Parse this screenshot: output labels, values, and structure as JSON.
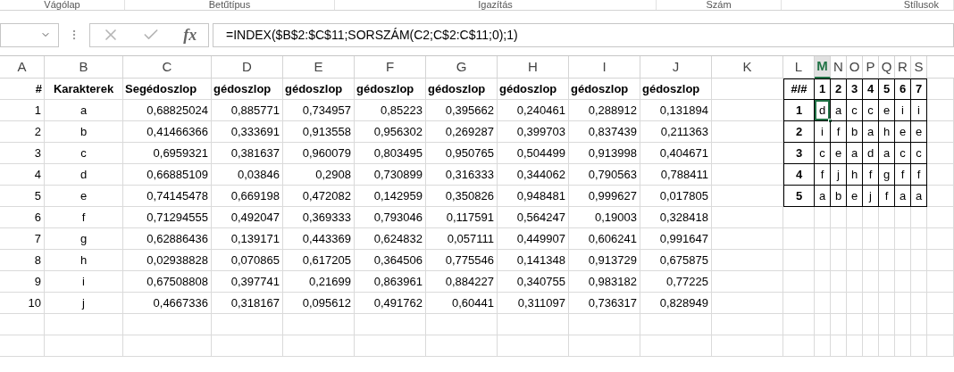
{
  "ribbon_groups": [
    {
      "label": "Vágólap"
    },
    {
      "label": "Betűtípus"
    },
    {
      "label": "Igazítás"
    },
    {
      "label": "Szám"
    },
    {
      "label": "Stílusok"
    }
  ],
  "formula_bar": {
    "insert_function": "fx",
    "formula": "=INDEX($B$2:$C$11;SORSZÁM(C2;C$2:C$11;0);1)"
  },
  "column_headers": [
    {
      "label": "A",
      "selected": false
    },
    {
      "label": "B",
      "selected": false
    },
    {
      "label": "C",
      "selected": false
    },
    {
      "label": "D",
      "selected": false
    },
    {
      "label": "E",
      "selected": false
    },
    {
      "label": "F",
      "selected": false
    },
    {
      "label": "G",
      "selected": false
    },
    {
      "label": "H",
      "selected": false
    },
    {
      "label": "I",
      "selected": false
    },
    {
      "label": "J",
      "selected": false
    },
    {
      "label": "K",
      "selected": false
    },
    {
      "label": "L",
      "selected": false
    },
    {
      "label": "M",
      "selected": true
    },
    {
      "label": "N",
      "selected": false
    },
    {
      "label": "O",
      "selected": false
    },
    {
      "label": "P",
      "selected": false
    },
    {
      "label": "Q",
      "selected": false
    },
    {
      "label": "R",
      "selected": false
    },
    {
      "label": "S",
      "selected": false
    }
  ],
  "table": {
    "columns": [
      "#",
      "Karakterek",
      "Segédoszlop",
      "gédoszlop",
      "gédoszlop",
      "gédoszlop",
      "gédoszlop",
      "gédoszlop",
      "gédoszlop",
      "gédoszlop"
    ],
    "rows": [
      [
        "1",
        "a",
        "0,68825024",
        "0,885771",
        "0,734957",
        "0,85223",
        "0,395662",
        "0,240461",
        "0,288912",
        "0,131894"
      ],
      [
        "2",
        "b",
        "0,41466366",
        "0,333691",
        "0,913558",
        "0,956302",
        "0,269287",
        "0,399703",
        "0,837439",
        "0,211363"
      ],
      [
        "3",
        "c",
        "0,6959321",
        "0,381637",
        "0,960079",
        "0,803495",
        "0,950765",
        "0,504499",
        "0,913998",
        "0,404671"
      ],
      [
        "4",
        "d",
        "0,66885109",
        "0,03846",
        "0,2908",
        "0,730899",
        "0,316333",
        "0,344062",
        "0,790563",
        "0,788411"
      ],
      [
        "5",
        "e",
        "0,74145478",
        "0,669198",
        "0,472082",
        "0,142959",
        "0,350826",
        "0,948481",
        "0,999627",
        "0,017805"
      ],
      [
        "6",
        "f",
        "0,71294555",
        "0,492047",
        "0,369333",
        "0,793046",
        "0,117591",
        "0,564247",
        "0,19003",
        "0,328418"
      ],
      [
        "7",
        "g",
        "0,62886436",
        "0,139171",
        "0,443369",
        "0,624832",
        "0,057111",
        "0,449907",
        "0,606241",
        "0,991647"
      ],
      [
        "8",
        "h",
        "0,02938828",
        "0,070865",
        "0,617205",
        "0,364506",
        "0,775546",
        "0,141348",
        "0,913729",
        "0,675875"
      ],
      [
        "9",
        "i",
        "0,67508808",
        "0,397741",
        "0,21699",
        "0,863961",
        "0,884227",
        "0,340755",
        "0,983182",
        "0,77225"
      ],
      [
        "10",
        "j",
        "0,4667336",
        "0,318167",
        "0,095612",
        "0,491762",
        "0,60441",
        "0,311097",
        "0,736317",
        "0,828949"
      ]
    ]
  },
  "lookup_table": {
    "corner": "#/#",
    "columns": [
      "1",
      "2",
      "3",
      "4",
      "5",
      "6",
      "7"
    ],
    "rows": [
      {
        "label": "1",
        "cells": [
          {
            "value": "d",
            "selected": true
          },
          {
            "value": "a",
            "selected": false
          },
          {
            "value": "c",
            "selected": false
          },
          {
            "value": "c",
            "selected": false
          },
          {
            "value": "e",
            "selected": false
          },
          {
            "value": "i",
            "selected": false
          },
          {
            "value": "i",
            "selected": false
          }
        ]
      },
      {
        "label": "2",
        "cells": [
          {
            "value": "i",
            "selected": false
          },
          {
            "value": "f",
            "selected": false
          },
          {
            "value": "b",
            "selected": false
          },
          {
            "value": "a",
            "selected": false
          },
          {
            "value": "h",
            "selected": false
          },
          {
            "value": "e",
            "selected": false
          },
          {
            "value": "e",
            "selected": false
          }
        ]
      },
      {
        "label": "3",
        "cells": [
          {
            "value": "c",
            "selected": false
          },
          {
            "value": "e",
            "selected": false
          },
          {
            "value": "a",
            "selected": false
          },
          {
            "value": "d",
            "selected": false
          },
          {
            "value": "a",
            "selected": false
          },
          {
            "value": "c",
            "selected": false
          },
          {
            "value": "c",
            "selected": false
          }
        ]
      },
      {
        "label": "4",
        "cells": [
          {
            "value": "f",
            "selected": false
          },
          {
            "value": "j",
            "selected": false
          },
          {
            "value": "h",
            "selected": false
          },
          {
            "value": "f",
            "selected": false
          },
          {
            "value": "g",
            "selected": false
          },
          {
            "value": "f",
            "selected": false
          },
          {
            "value": "f",
            "selected": false
          }
        ]
      },
      {
        "label": "5",
        "cells": [
          {
            "value": "a",
            "selected": false
          },
          {
            "value": "b",
            "selected": false
          },
          {
            "value": "e",
            "selected": false
          },
          {
            "value": "j",
            "selected": false
          },
          {
            "value": "f",
            "selected": false
          },
          {
            "value": "a",
            "selected": false
          },
          {
            "value": "a",
            "selected": false
          }
        ]
      }
    ]
  }
}
